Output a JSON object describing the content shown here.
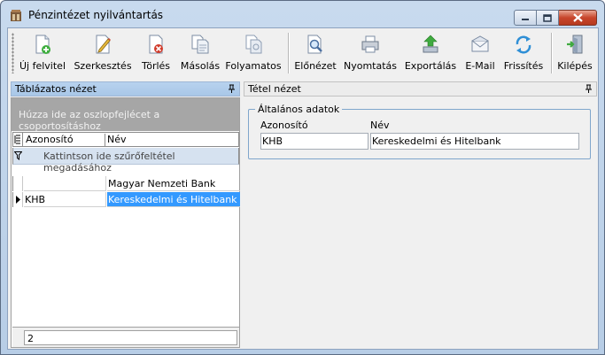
{
  "window": {
    "title": "Pénzintézet nyilvántartás",
    "icon": "app-icon",
    "controls": [
      "minimize-icon",
      "maximize-icon",
      "close-icon"
    ]
  },
  "toolbar": {
    "buttons": [
      {
        "label": "Új felvitel",
        "icon": "new-document-icon"
      },
      {
        "label": "Szerkesztés",
        "icon": "edit-pencil-icon"
      },
      {
        "label": "Törlés",
        "icon": "delete-document-icon"
      },
      {
        "label": "Másolás",
        "icon": "copy-documents-icon"
      },
      {
        "label": "Folyamatos",
        "icon": "continuous-documents-icon"
      },
      {
        "label": "Előnézet",
        "icon": "preview-magnifier-icon"
      },
      {
        "label": "Nyomtatás",
        "icon": "printer-icon"
      },
      {
        "label": "Exportálás",
        "icon": "export-arrow-icon"
      },
      {
        "label": "E-Mail",
        "icon": "envelope-icon"
      },
      {
        "label": "Frissítés",
        "icon": "refresh-icon"
      },
      {
        "label": "Kilépés",
        "icon": "exit-door-icon"
      }
    ]
  },
  "left_panel": {
    "title": "Táblázatos nézet",
    "group_hint": "Húzza ide az oszlopfejlécet a csoportosításhoz",
    "columns": [
      "Azonosító",
      "Név"
    ],
    "filter_hint": "Kattintson ide szűrőfeltétel megadásához",
    "rows": [
      {
        "id": "",
        "name": "Magyar Nemzeti Bank",
        "selected": false
      },
      {
        "id": "KHB",
        "name": "Kereskedelmi és Hitelbank",
        "selected": true
      }
    ],
    "footer_count": "2"
  },
  "right_panel": {
    "title": "Tétel nézet",
    "group_title": "Általános adatok",
    "fields": {
      "id_label": "Azonosító",
      "id_value": "KHB",
      "name_label": "Név",
      "name_value": "Kereskedelmi és Hitelbank"
    }
  },
  "colors": {
    "selection": "#3399ff",
    "panel_header": "#b8d2ee",
    "group_area": "#a6a6a6"
  }
}
